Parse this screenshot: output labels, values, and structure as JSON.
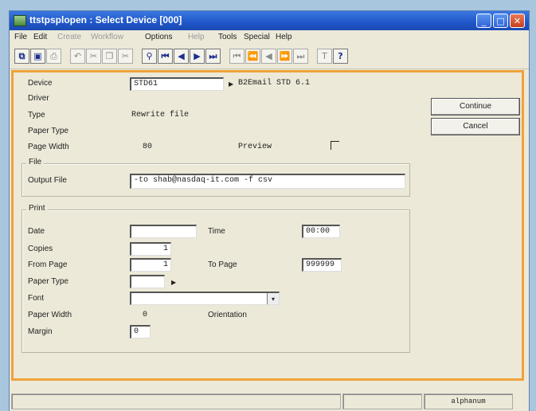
{
  "window": {
    "title": "ttstpsplopen : Select Device [000]",
    "controls": {
      "minimize": "_",
      "maximize": "□",
      "close": "✕"
    }
  },
  "menu": [
    "File",
    "Edit",
    "Create",
    "Workflow",
    "Options",
    "Help",
    "Tools",
    "Special",
    "Help"
  ],
  "toolbar_icons": [
    "window-icon",
    "save-icon",
    "print-icon",
    "undo-icon",
    "cut-icon",
    "copy-icon",
    "paste-icon",
    "find-icon",
    "first-icon",
    "previous-icon",
    "next-icon",
    "last-icon",
    "first-set-icon",
    "previous-set-icon",
    "previous-group-icon",
    "next-group-icon",
    "last-set-icon",
    "text-icon",
    "help-icon"
  ],
  "form": {
    "device_label": "Device",
    "device_value": "STD61",
    "device_desc": "B2Email STD 6.1",
    "driver_label": "Driver",
    "type_label": "Type",
    "type_value": "Rewrite file",
    "paper_type_label": "Paper Type",
    "page_width_label": "Page Width",
    "page_width_value": "80",
    "preview_label": "Preview",
    "file_group": "File",
    "output_file_label": "Output File",
    "output_file_value": "-to shab@nasdaq-it.com -f csv",
    "print_group": "Print",
    "date_label": "Date",
    "date_value": "",
    "time_label": "Time",
    "time_value": "00:00",
    "copies_label": "Copies",
    "copies_value": "1",
    "from_page_label": "From Page",
    "from_page_value": "1",
    "to_page_label": "To Page",
    "to_page_value": "999999",
    "paper_type2_label": "Paper Type",
    "font_label": "Font",
    "paper_width_label": "Paper Width",
    "paper_width_value": "0",
    "orientation_label": "Orientation",
    "margin_label": "Margin",
    "margin_value": "0"
  },
  "buttons": {
    "continue": "Continue",
    "cancel": "Cancel"
  },
  "status": {
    "mode": "alphanum"
  },
  "colors": {
    "accent_border": "#f0a23a",
    "titlebar": "#1f56c8"
  }
}
